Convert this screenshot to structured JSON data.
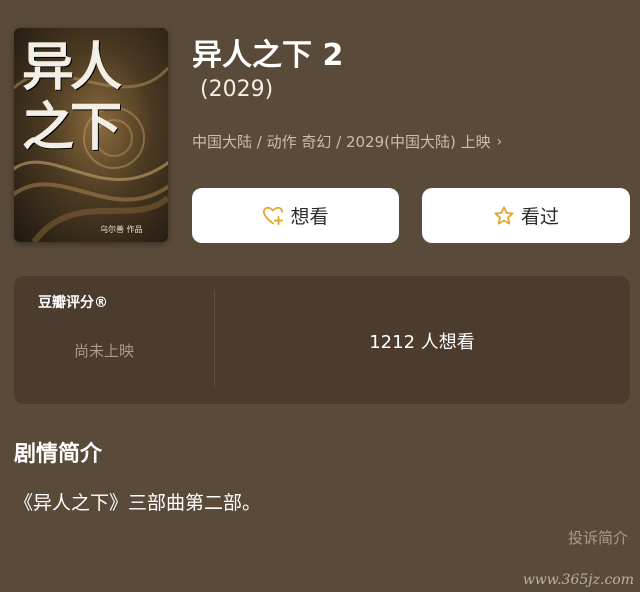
{
  "movie": {
    "poster": {
      "title_text": "异人之下",
      "credit_text": "乌尔善 作品"
    },
    "title": "异人之下 2",
    "year": "(2029)",
    "meta": "中国大陆 / 动作 奇幻 / 2029(中国大陆) 上映",
    "meta_chevron": "›"
  },
  "actions": {
    "want_label": "想看",
    "seen_label": "看过"
  },
  "rating": {
    "title": "豆瓣评分®",
    "status": "尚未上映",
    "want_count": "1212 人想看"
  },
  "synopsis": {
    "heading": "剧情简介",
    "text": "《异人之下》三部曲第二部。",
    "report_label": "投诉简介"
  },
  "watermark": "www.365jz.com",
  "colors": {
    "background": "#5a4a39",
    "card": "#4b3c2d",
    "accent": "#e3a72f",
    "muted": "#a99c8c"
  },
  "icons": {
    "want": "heart-plus-icon",
    "seen": "star-icon",
    "meta_more": "chevron-right-icon"
  }
}
